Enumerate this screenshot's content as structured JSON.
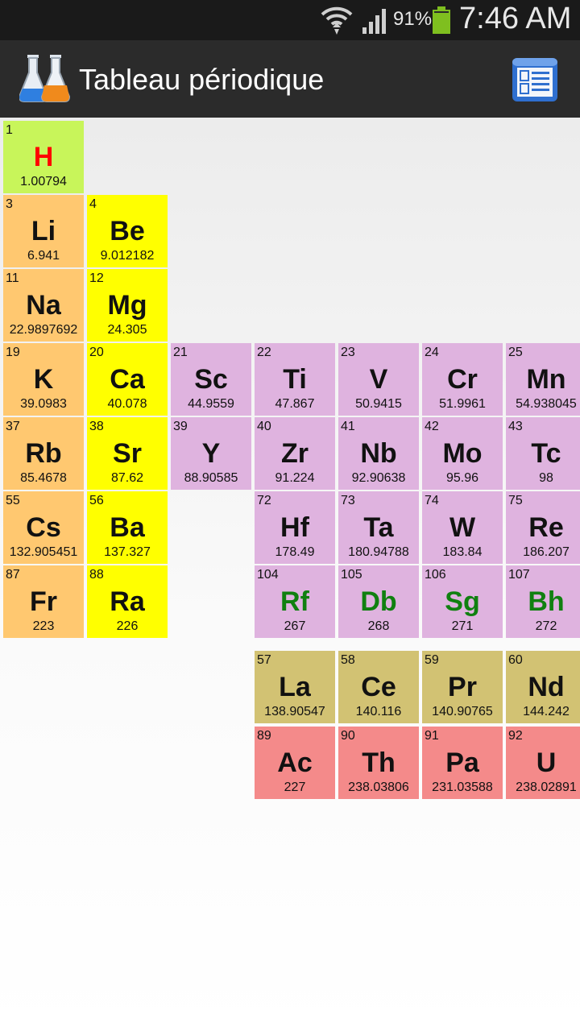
{
  "status_bar": {
    "battery_percent": "91%",
    "time": "7:46 AM",
    "icons": [
      "wifi-icon",
      "signal-icon",
      "battery-icon"
    ],
    "battery_color": "#7fbf1f"
  },
  "action_bar": {
    "title": "Tableau périodique",
    "app_icon": "flasks-icon",
    "menu_icon": "list-view-icon"
  },
  "colors": {
    "nonmetal": "#c8f55a",
    "alkali": "#ffc870",
    "alkaline_earth": "#ffff00",
    "transition": "#dfb3df",
    "lanthanide": "#d2c273",
    "actinide": "#f48a8a",
    "symbol_default": "#111111",
    "symbol_gas": "#ff0000",
    "symbol_synthetic": "#108010"
  },
  "elements": [
    {
      "number": "1",
      "symbol": "H",
      "mass": "1.00794",
      "group": "nonmetal",
      "state": "gas",
      "col": 1,
      "row": 1
    },
    {
      "number": "3",
      "symbol": "Li",
      "mass": "6.941",
      "group": "alkali",
      "state": "solid",
      "col": 1,
      "row": 2
    },
    {
      "number": "4",
      "symbol": "Be",
      "mass": "9.012182",
      "group": "alkaline_earth",
      "state": "solid",
      "col": 2,
      "row": 2
    },
    {
      "number": "11",
      "symbol": "Na",
      "mass": "22.9897692",
      "group": "alkali",
      "state": "solid",
      "col": 1,
      "row": 3
    },
    {
      "number": "12",
      "symbol": "Mg",
      "mass": "24.305",
      "group": "alkaline_earth",
      "state": "solid",
      "col": 2,
      "row": 3
    },
    {
      "number": "19",
      "symbol": "K",
      "mass": "39.0983",
      "group": "alkali",
      "state": "solid",
      "col": 1,
      "row": 4
    },
    {
      "number": "20",
      "symbol": "Ca",
      "mass": "40.078",
      "group": "alkaline_earth",
      "state": "solid",
      "col": 2,
      "row": 4
    },
    {
      "number": "21",
      "symbol": "Sc",
      "mass": "44.9559",
      "group": "transition",
      "state": "solid",
      "col": 3,
      "row": 4
    },
    {
      "number": "22",
      "symbol": "Ti",
      "mass": "47.867",
      "group": "transition",
      "state": "solid",
      "col": 4,
      "row": 4
    },
    {
      "number": "23",
      "symbol": "V",
      "mass": "50.9415",
      "group": "transition",
      "state": "solid",
      "col": 5,
      "row": 4
    },
    {
      "number": "24",
      "symbol": "Cr",
      "mass": "51.9961",
      "group": "transition",
      "state": "solid",
      "col": 6,
      "row": 4
    },
    {
      "number": "25",
      "symbol": "Mn",
      "mass": "54.938045",
      "group": "transition",
      "state": "solid",
      "col": 7,
      "row": 4
    },
    {
      "number": "37",
      "symbol": "Rb",
      "mass": "85.4678",
      "group": "alkali",
      "state": "solid",
      "col": 1,
      "row": 5
    },
    {
      "number": "38",
      "symbol": "Sr",
      "mass": "87.62",
      "group": "alkaline_earth",
      "state": "solid",
      "col": 2,
      "row": 5
    },
    {
      "number": "39",
      "symbol": "Y",
      "mass": "88.90585",
      "group": "transition",
      "state": "solid",
      "col": 3,
      "row": 5
    },
    {
      "number": "40",
      "symbol": "Zr",
      "mass": "91.224",
      "group": "transition",
      "state": "solid",
      "col": 4,
      "row": 5
    },
    {
      "number": "41",
      "symbol": "Nb",
      "mass": "92.90638",
      "group": "transition",
      "state": "solid",
      "col": 5,
      "row": 5
    },
    {
      "number": "42",
      "symbol": "Mo",
      "mass": "95.96",
      "group": "transition",
      "state": "solid",
      "col": 6,
      "row": 5
    },
    {
      "number": "43",
      "symbol": "Tc",
      "mass": "98",
      "group": "transition",
      "state": "solid",
      "col": 7,
      "row": 5
    },
    {
      "number": "55",
      "symbol": "Cs",
      "mass": "132.905451",
      "group": "alkali",
      "state": "solid",
      "col": 1,
      "row": 6
    },
    {
      "number": "56",
      "symbol": "Ba",
      "mass": "137.327",
      "group": "alkaline_earth",
      "state": "solid",
      "col": 2,
      "row": 6
    },
    {
      "number": "72",
      "symbol": "Hf",
      "mass": "178.49",
      "group": "transition",
      "state": "solid",
      "col": 4,
      "row": 6
    },
    {
      "number": "73",
      "symbol": "Ta",
      "mass": "180.94788",
      "group": "transition",
      "state": "solid",
      "col": 5,
      "row": 6
    },
    {
      "number": "74",
      "symbol": "W",
      "mass": "183.84",
      "group": "transition",
      "state": "solid",
      "col": 6,
      "row": 6
    },
    {
      "number": "75",
      "symbol": "Re",
      "mass": "186.207",
      "group": "transition",
      "state": "solid",
      "col": 7,
      "row": 6
    },
    {
      "number": "87",
      "symbol": "Fr",
      "mass": "223",
      "group": "alkali",
      "state": "solid",
      "col": 1,
      "row": 7
    },
    {
      "number": "88",
      "symbol": "Ra",
      "mass": "226",
      "group": "alkaline_earth",
      "state": "solid",
      "col": 2,
      "row": 7
    },
    {
      "number": "104",
      "symbol": "Rf",
      "mass": "267",
      "group": "transition",
      "state": "synthetic",
      "col": 4,
      "row": 7
    },
    {
      "number": "105",
      "symbol": "Db",
      "mass": "268",
      "group": "transition",
      "state": "synthetic",
      "col": 5,
      "row": 7
    },
    {
      "number": "106",
      "symbol": "Sg",
      "mass": "271",
      "group": "transition",
      "state": "synthetic",
      "col": 6,
      "row": 7
    },
    {
      "number": "107",
      "symbol": "Bh",
      "mass": "272",
      "group": "transition",
      "state": "synthetic",
      "col": 7,
      "row": 7
    },
    {
      "number": "57",
      "symbol": "La",
      "mass": "138.90547",
      "group": "lanthanide",
      "state": "solid",
      "col": 4,
      "row": 8
    },
    {
      "number": "58",
      "symbol": "Ce",
      "mass": "140.116",
      "group": "lanthanide",
      "state": "solid",
      "col": 5,
      "row": 8
    },
    {
      "number": "59",
      "symbol": "Pr",
      "mass": "140.90765",
      "group": "lanthanide",
      "state": "solid",
      "col": 6,
      "row": 8
    },
    {
      "number": "60",
      "symbol": "Nd",
      "mass": "144.242",
      "group": "lanthanide",
      "state": "solid",
      "col": 7,
      "row": 8
    },
    {
      "number": "89",
      "symbol": "Ac",
      "mass": "227",
      "group": "actinide",
      "state": "solid",
      "col": 4,
      "row": 9
    },
    {
      "number": "90",
      "symbol": "Th",
      "mass": "238.03806",
      "group": "actinide",
      "state": "solid",
      "col": 5,
      "row": 9
    },
    {
      "number": "91",
      "symbol": "Pa",
      "mass": "231.03588",
      "group": "actinide",
      "state": "solid",
      "col": 6,
      "row": 9
    },
    {
      "number": "92",
      "symbol": "U",
      "mass": "238.02891",
      "group": "actinide",
      "state": "solid",
      "col": 7,
      "row": 9
    }
  ]
}
